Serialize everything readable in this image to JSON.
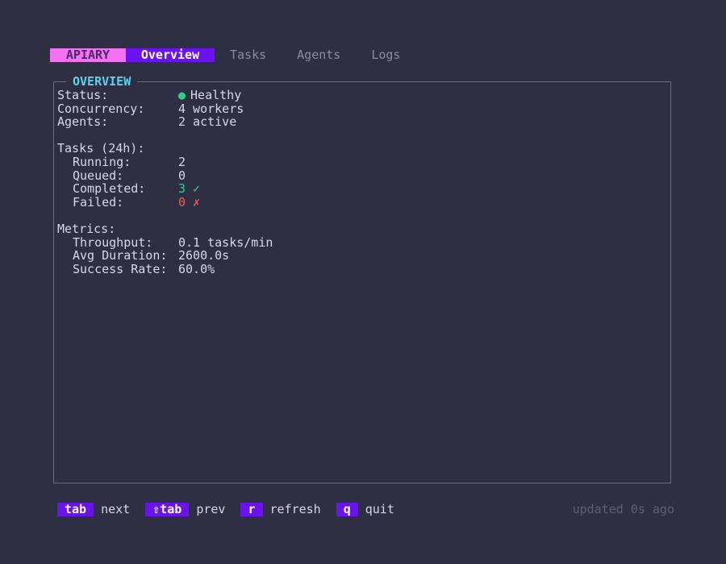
{
  "header": {
    "brand": "APIARY",
    "tabs": [
      {
        "label": "Overview",
        "active": true
      },
      {
        "label": "Tasks",
        "active": false
      },
      {
        "label": "Agents",
        "active": false
      },
      {
        "label": "Logs",
        "active": false
      }
    ]
  },
  "panel": {
    "title": "OVERVIEW",
    "status": {
      "label": "Status:",
      "icon": "status-dot-icon",
      "value": "Healthy",
      "color": "#2ed18a"
    },
    "concurrency": {
      "label": "Concurrency:",
      "value": "4 workers"
    },
    "agents": {
      "label": "Agents:",
      "value": "2 active"
    },
    "tasks": {
      "heading": "Tasks (24h):",
      "running": {
        "label": "Running:",
        "value": "2"
      },
      "queued": {
        "label": "Queued:",
        "value": "0"
      },
      "completed": {
        "label": "Completed:",
        "value": "3",
        "mark": "✓",
        "color": "#2ed18a"
      },
      "failed": {
        "label": "Failed:",
        "value": "0",
        "mark": "✗",
        "color": "#f05a5a"
      }
    },
    "metrics": {
      "heading": "Metrics:",
      "throughput": {
        "label": "Throughput:",
        "value": "0.1 tasks/min"
      },
      "avg_duration": {
        "label": "Avg Duration:",
        "value": "2600.0s"
      },
      "success_rate": {
        "label": "Success Rate:",
        "value": "60.0%"
      }
    }
  },
  "footer": {
    "keys": [
      {
        "key": "tab",
        "desc": "next"
      },
      {
        "key": "⇧tab",
        "desc": "prev"
      },
      {
        "key": "r",
        "desc": "refresh"
      },
      {
        "key": "q",
        "desc": "quit"
      }
    ],
    "updated": "updated 0s ago"
  },
  "colors": {
    "background": "#2e2f42",
    "accent": "#6a12f0",
    "brand": "#f472f0",
    "panel_title": "#5fd0f0",
    "ok": "#2ed18a",
    "error": "#f05a5a"
  }
}
